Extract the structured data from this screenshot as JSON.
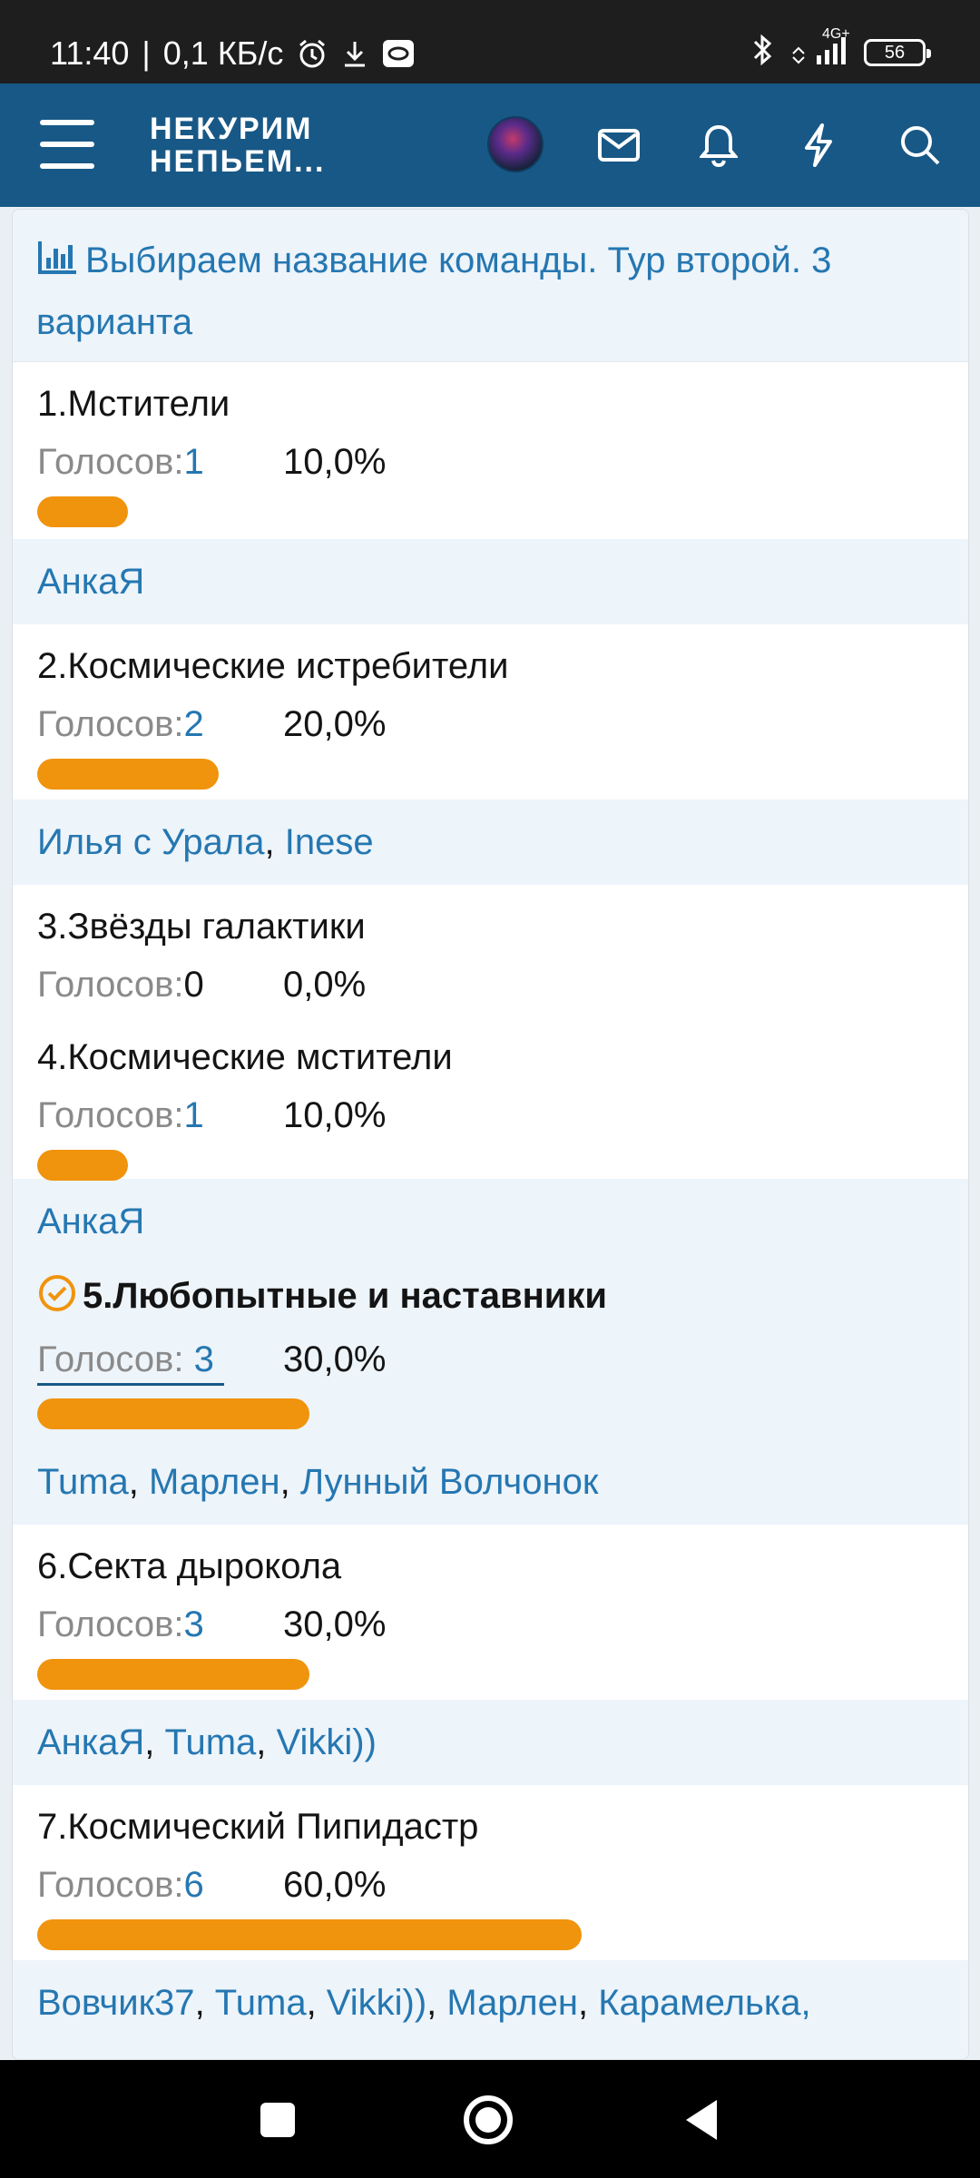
{
  "status_bar": {
    "time": "11:40",
    "speed": "0,1 КБ/с",
    "network": "4G+",
    "battery": "56"
  },
  "header": {
    "logo_line1": "НЕКУРИМ",
    "logo_line2": "НЕПЬЕМ..."
  },
  "poll": {
    "title": "Выбираем название команды. Тур второй. 3 варианта",
    "votes_label": "Голосов: ",
    "options": [
      {
        "name": "1.Мстители",
        "count": "1",
        "percent": "10,0%",
        "share": 0.1,
        "voters": [
          "АнкаЯ"
        ]
      },
      {
        "name": "2.Космические истребители",
        "count": "2",
        "percent": "20,0%",
        "share": 0.2,
        "voters": [
          "Илья с Урала",
          "Inese"
        ]
      },
      {
        "name": "3.Звёзды галактики",
        "count": "0",
        "percent": "0,0%",
        "share": 0.0,
        "voters": []
      },
      {
        "name": "4.Космические мстители",
        "count": "1",
        "percent": "10,0%",
        "share": 0.1,
        "voters": [
          "АнкаЯ"
        ]
      },
      {
        "name": "5.Любопытные и наставники",
        "count": "3",
        "percent": "30,0%",
        "share": 0.3,
        "voters": [
          "Tuma",
          "Марлен",
          "Лунный Волчонок"
        ],
        "selected": true
      },
      {
        "name": "6.Секта дырокола",
        "count": "3",
        "percent": "30,0%",
        "share": 0.3,
        "voters": [
          "АнкаЯ",
          "Tuma",
          "Vikki))"
        ]
      },
      {
        "name": "7.Космический Пипидастр",
        "count": "6",
        "percent": "60,0%",
        "share": 0.6,
        "voters": [
          "Вовчик37",
          "Tuma",
          "Vikki))",
          "Марлен",
          "Карамелька,"
        ]
      }
    ]
  },
  "colors": {
    "header_bg": "#185886",
    "link": "#2577b1",
    "bar": "#f0930d",
    "alt_row": "#edf4fa"
  }
}
